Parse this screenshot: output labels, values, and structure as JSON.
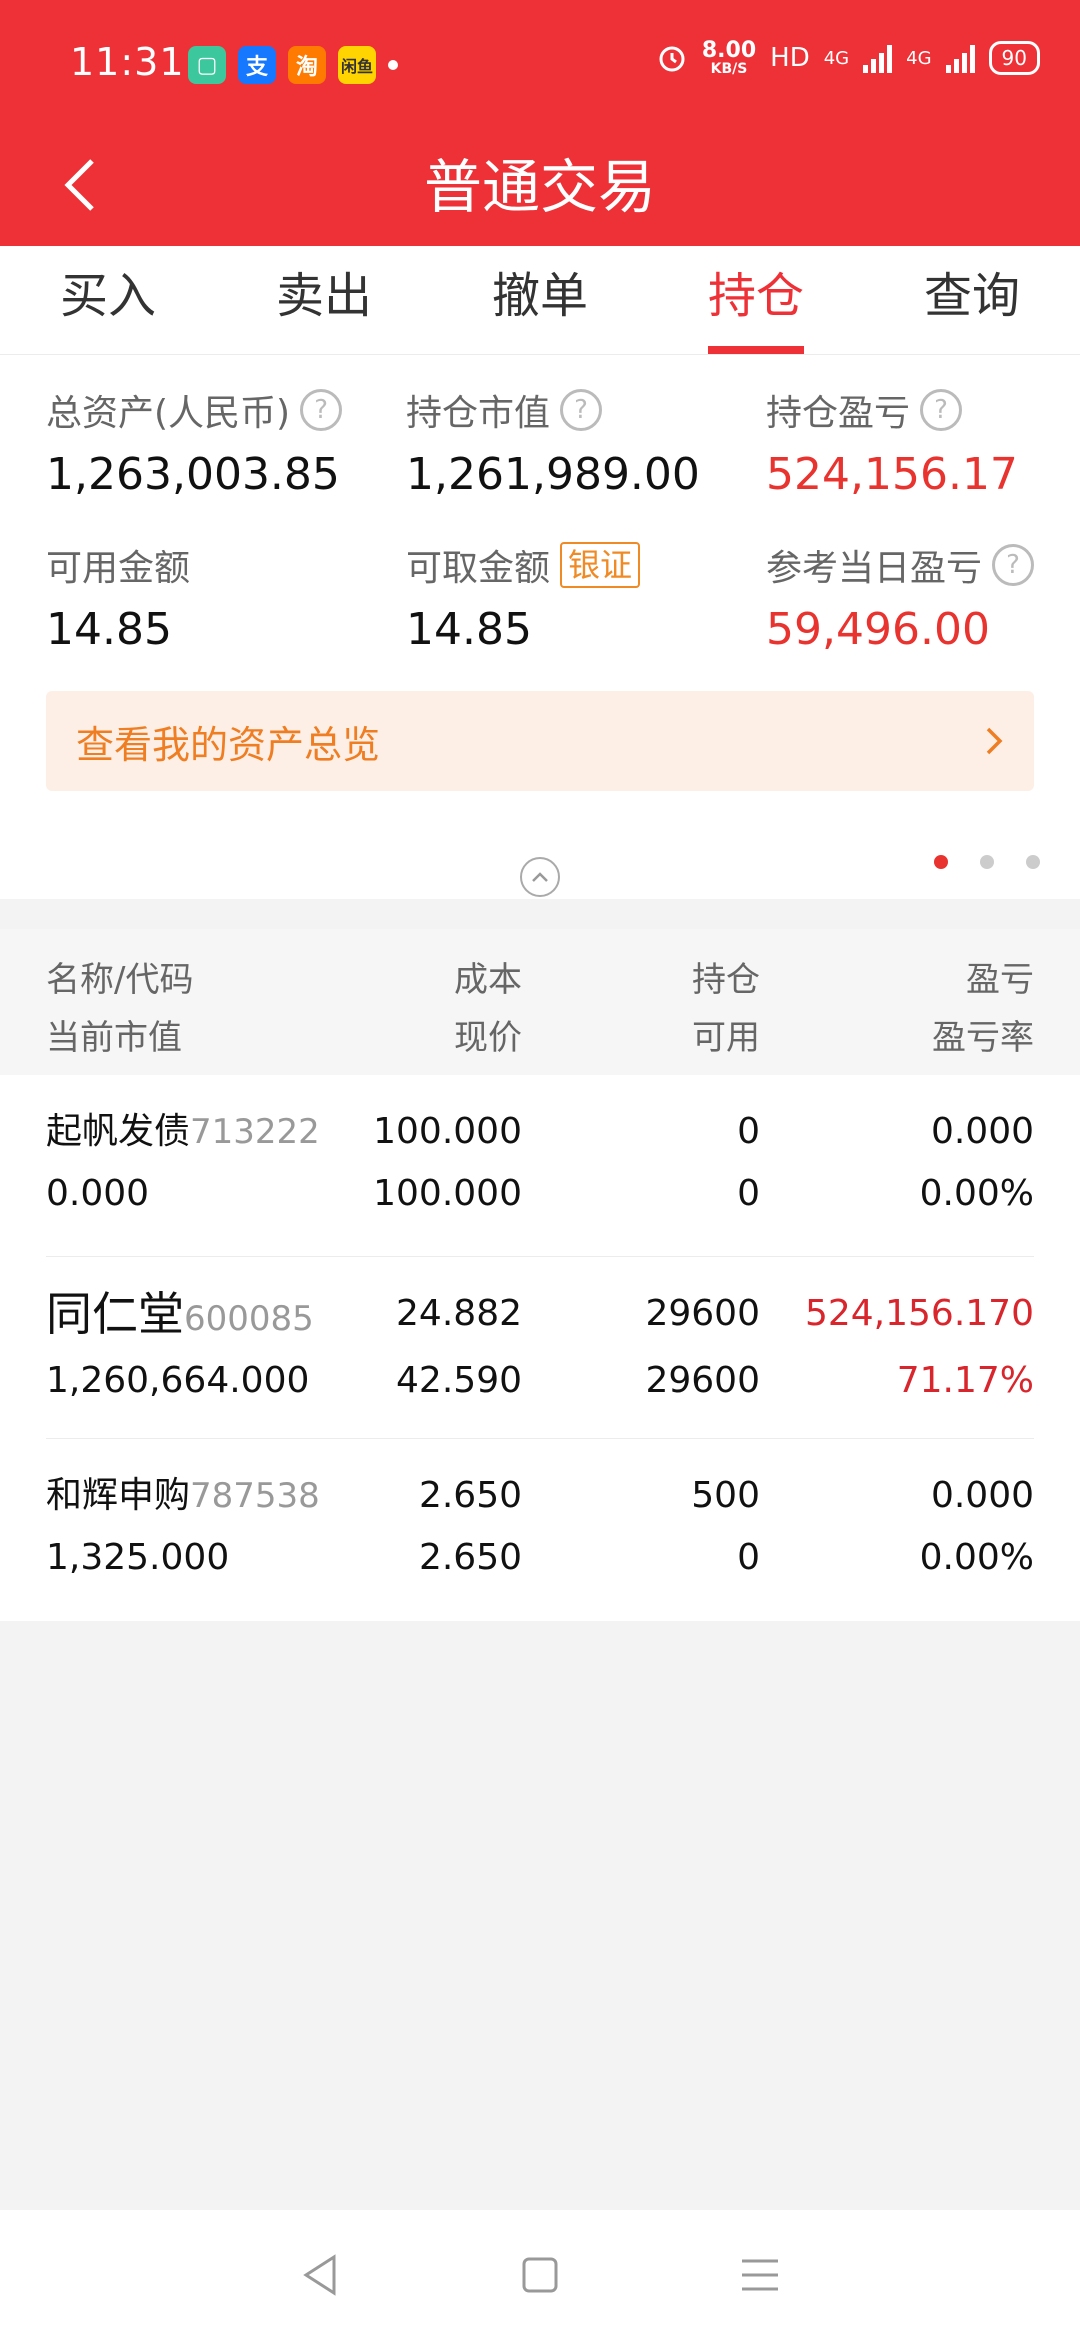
{
  "status": {
    "time": "11:31",
    "apps": [
      "▢",
      "支",
      "淘",
      "闲鱼"
    ],
    "speed_value": "8.00",
    "speed_unit": "KB/S",
    "hd": "HD",
    "net1": "4G",
    "net2": "4G",
    "battery": "90"
  },
  "header": {
    "title": "普通交易"
  },
  "tabs": [
    "买入",
    "卖出",
    "撤单",
    "持仓",
    "查询"
  ],
  "summary": {
    "total_assets_label": "总资产(人民币)",
    "total_assets": "1,263,003.85",
    "market_value_label": "持仓市值",
    "market_value": "1,261,989.00",
    "pnl_label": "持仓盈亏",
    "pnl": "524,156.17",
    "available_label": "可用金额",
    "available": "14.85",
    "withdrawable_label": "可取金额",
    "withdrawable_badge": "银证",
    "withdrawable": "14.85",
    "daily_pnl_label": "参考当日盈亏",
    "daily_pnl": "59,496.00",
    "overview_label": "查看我的资产总览"
  },
  "table": {
    "headers_row1": [
      "名称/代码",
      "成本",
      "持仓",
      "盈亏"
    ],
    "headers_row2": [
      "当前市值",
      "现价",
      "可用",
      "盈亏率"
    ],
    "rows": [
      {
        "name": "起帆发债",
        "code": "713222",
        "cost": "100.000",
        "position": "0",
        "pnl": "0.000",
        "market_value": "0.000",
        "price": "100.000",
        "available": "0",
        "pnl_rate": "0.00%"
      },
      {
        "name": "同仁堂",
        "code": "600085",
        "cost": "24.882",
        "position": "29600",
        "pnl": "524,156.170",
        "market_value": "1,260,664.000",
        "price": "42.590",
        "available": "29600",
        "pnl_rate": "71.17%"
      },
      {
        "name": "和辉申购",
        "code": "787538",
        "cost": "2.650",
        "position": "500",
        "pnl": "0.000",
        "market_value": "1,325.000",
        "price": "2.650",
        "available": "0",
        "pnl_rate": "0.00%"
      }
    ]
  },
  "colors": {
    "brand": "#ee3137",
    "positive": "#d9252c",
    "accent": "#ef7d22"
  }
}
